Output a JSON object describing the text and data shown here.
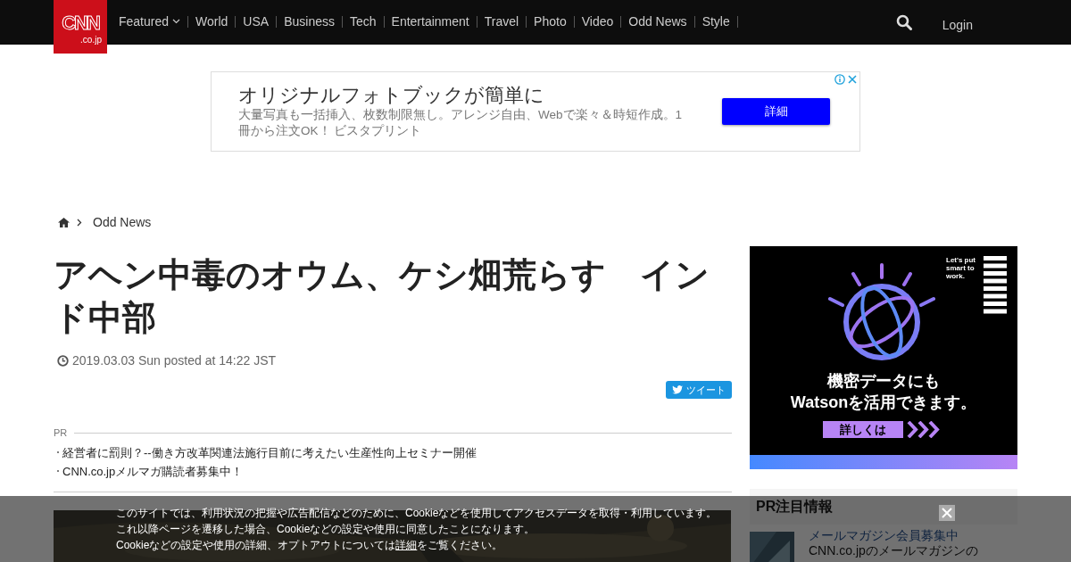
{
  "header": {
    "logo": {
      "main": "CNN",
      "sub": ".co.jp"
    },
    "nav": [
      {
        "label": "Featured",
        "dropdown": true
      },
      {
        "label": "World",
        "dropdown": false
      },
      {
        "label": "USA",
        "dropdown": false
      },
      {
        "label": "Business",
        "dropdown": false
      },
      {
        "label": "Tech",
        "dropdown": false
      },
      {
        "label": "Entertainment",
        "dropdown": false
      },
      {
        "label": "Travel",
        "dropdown": false
      },
      {
        "label": "Photo",
        "dropdown": false
      },
      {
        "label": "Video",
        "dropdown": false
      },
      {
        "label": "Odd News",
        "dropdown": false
      },
      {
        "label": "Style",
        "dropdown": false
      }
    ],
    "login": "Login"
  },
  "ad_banner": {
    "title": "オリジナルフォトブックが簡単に",
    "description": "大量写真も一括挿入、枚数制限無し。アレンジ自由、Webで楽々＆時短作成。1冊から注文OK！ ビスタプリント",
    "button": "詳細"
  },
  "breadcrumb": {
    "items": [
      "Odd News"
    ]
  },
  "article": {
    "title": "アヘン中毒のオウム、ケシ畑荒らす　インド中部",
    "date": "2019.03.03 Sun posted at 14:22 JST",
    "tweet_button": "ツイート",
    "pr": {
      "label": "PR",
      "items": [
        "経営者に罰則？--働き方改革関連法施行目前に考えたい生産性向上セミナー開催",
        "CNN.co.jpメルマガ購読者募集中！"
      ]
    }
  },
  "sidebar": {
    "ad": {
      "tagline": "Let's put smart to work.",
      "headline": [
        "機密データにも",
        "Watsonを活用できます。"
      ],
      "button": "詳しくは"
    },
    "pr_box": {
      "heading": "PR注目情報",
      "items": [
        {
          "title": "メールマガジン会員募集中",
          "description": "CNN.co.jpのメールマガジンの"
        }
      ]
    }
  },
  "cookie_notice": {
    "lines": [
      {
        "text": "このサイトでは、利用状況の把握や広告配信などのために、Cookieなどを使用してアクセスデータを取得・利用しています。"
      },
      {
        "text": "これ以降ページを遷移した場合、Cookieなどの設定や使用に同意したことになります。"
      },
      {
        "text": "Cookieなどの設定や使用の詳細、オプトアウトについては",
        "link": "詳細",
        "after": "をご覧ください。"
      }
    ]
  }
}
